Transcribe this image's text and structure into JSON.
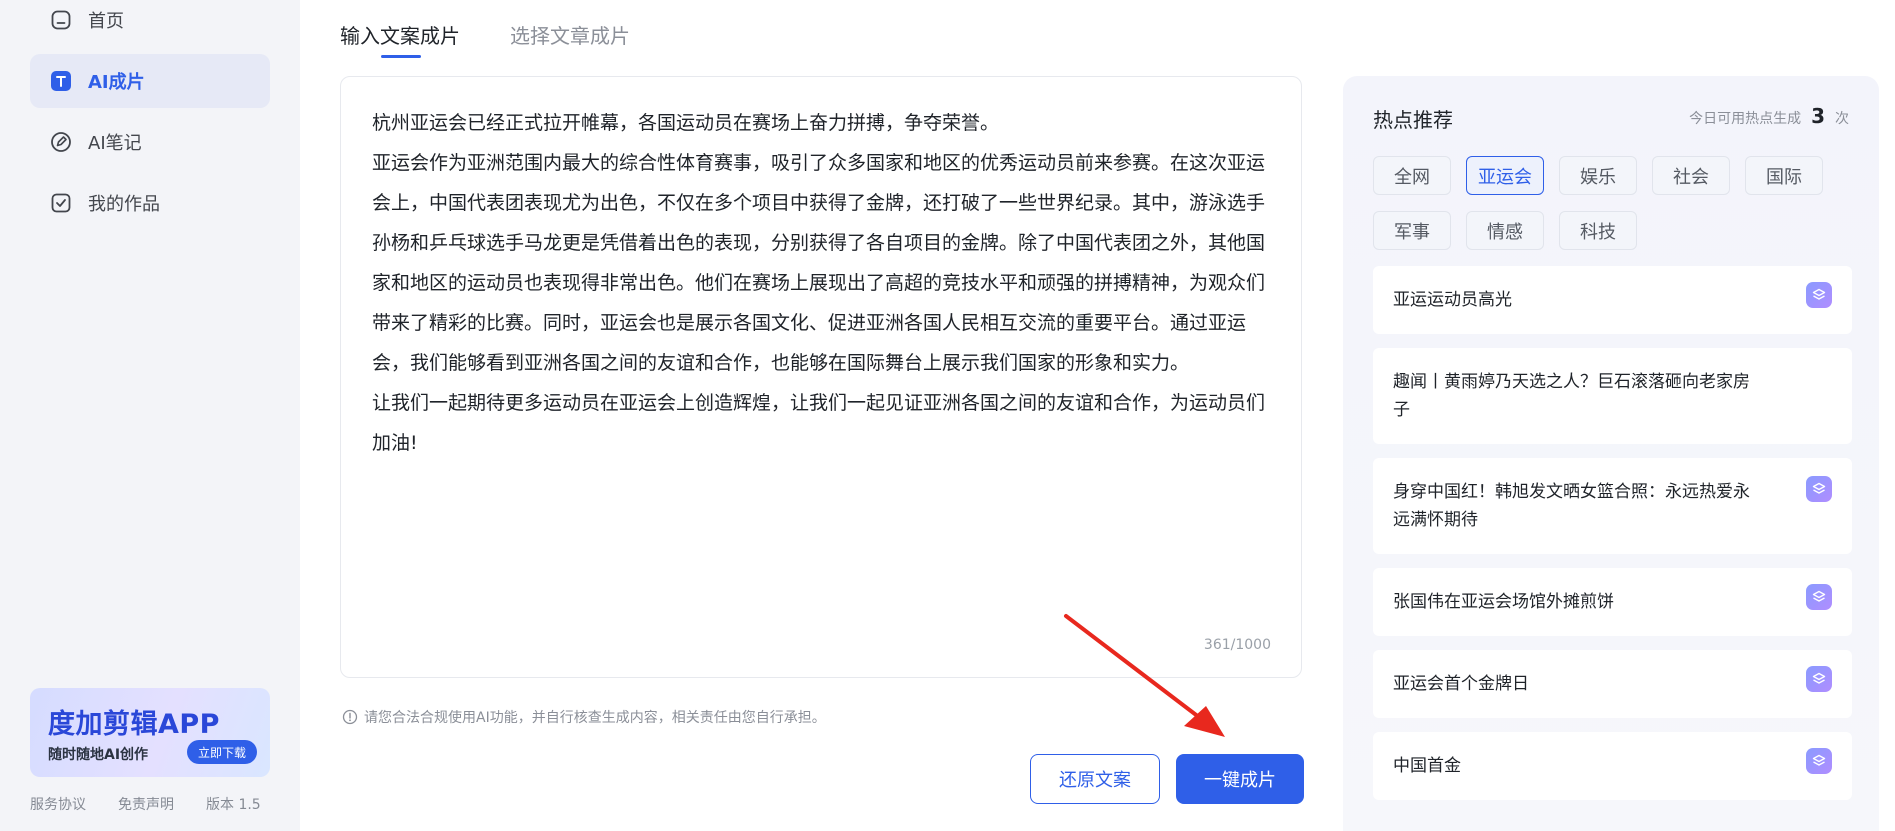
{
  "sidebar": {
    "items": [
      {
        "label": "首页"
      },
      {
        "label": "AI成片"
      },
      {
        "label": "AI笔记"
      },
      {
        "label": "我的作品"
      }
    ],
    "banner": {
      "title": "度加剪辑APP",
      "subtitle": "随时随地AI创作",
      "download_label": "立即下载"
    },
    "footer": {
      "service": "服务协议",
      "disclaimer": "免责声明",
      "version": "版本 1.5"
    }
  },
  "main": {
    "tabs": [
      {
        "label": "输入文案成片"
      },
      {
        "label": "选择文章成片"
      }
    ],
    "editor": {
      "paragraphs": [
        "杭州亚运会已经正式拉开帷幕，各国运动员在赛场上奋力拼搏，争夺荣誉。",
        "亚运会作为亚洲范围内最大的综合性体育赛事，吸引了众多国家和地区的优秀运动员前来参赛。在这次亚运会上，中国代表团表现尤为出色，不仅在多个项目中获得了金牌，还打破了一些世界纪录。其中，游泳选手孙杨和乒乓球选手马龙更是凭借着出色的表现，分别获得了各自项目的金牌。除了中国代表团之外，其他国家和地区的运动员也表现得非常出色。他们在赛场上展现出了高超的竞技水平和顽强的拼搏精神，为观众们带来了精彩的比赛。同时，亚运会也是展示各国文化、促进亚洲各国人民相互交流的重要平台。通过亚运会，我们能够看到亚洲各国之间的友谊和合作，也能够在国际舞台上展示我们国家的形象和实力。",
        "让我们一起期待更多运动员在亚运会上创造辉煌，让我们一起见证亚洲各国之间的友谊和合作，为运动员们加油!"
      ],
      "char_count": "361/1000"
    },
    "notice": "请您合法合规使用AI功能，并自行核查生成内容，相关责任由您自行承担。",
    "restore_label": "还原文案",
    "generate_label": "一键成片"
  },
  "hot": {
    "title": "热点推荐",
    "quota_label": "今日可用热点生成",
    "quota_count": "3",
    "quota_unit": "次",
    "categories": [
      "全网",
      "亚运会",
      "娱乐",
      "社会",
      "国际",
      "军事",
      "情感",
      "科技"
    ],
    "active_category": 1,
    "items": [
      {
        "title": "亚运运动员高光"
      },
      {
        "title": "趣闻丨黄雨婷乃天选之人？巨石滚落砸向老家房子"
      },
      {
        "title": "身穿中国红！韩旭发文晒女篮合照：永远热爱永远满怀期待"
      },
      {
        "title": "张国伟在亚运会场馆外摊煎饼"
      },
      {
        "title": "亚运会首个金牌日"
      },
      {
        "title": "中国首金"
      }
    ]
  },
  "colors": {
    "accent": "#2f5fe8",
    "sidebar_bg": "#f3f4f8",
    "arrow": "#e8281e"
  }
}
